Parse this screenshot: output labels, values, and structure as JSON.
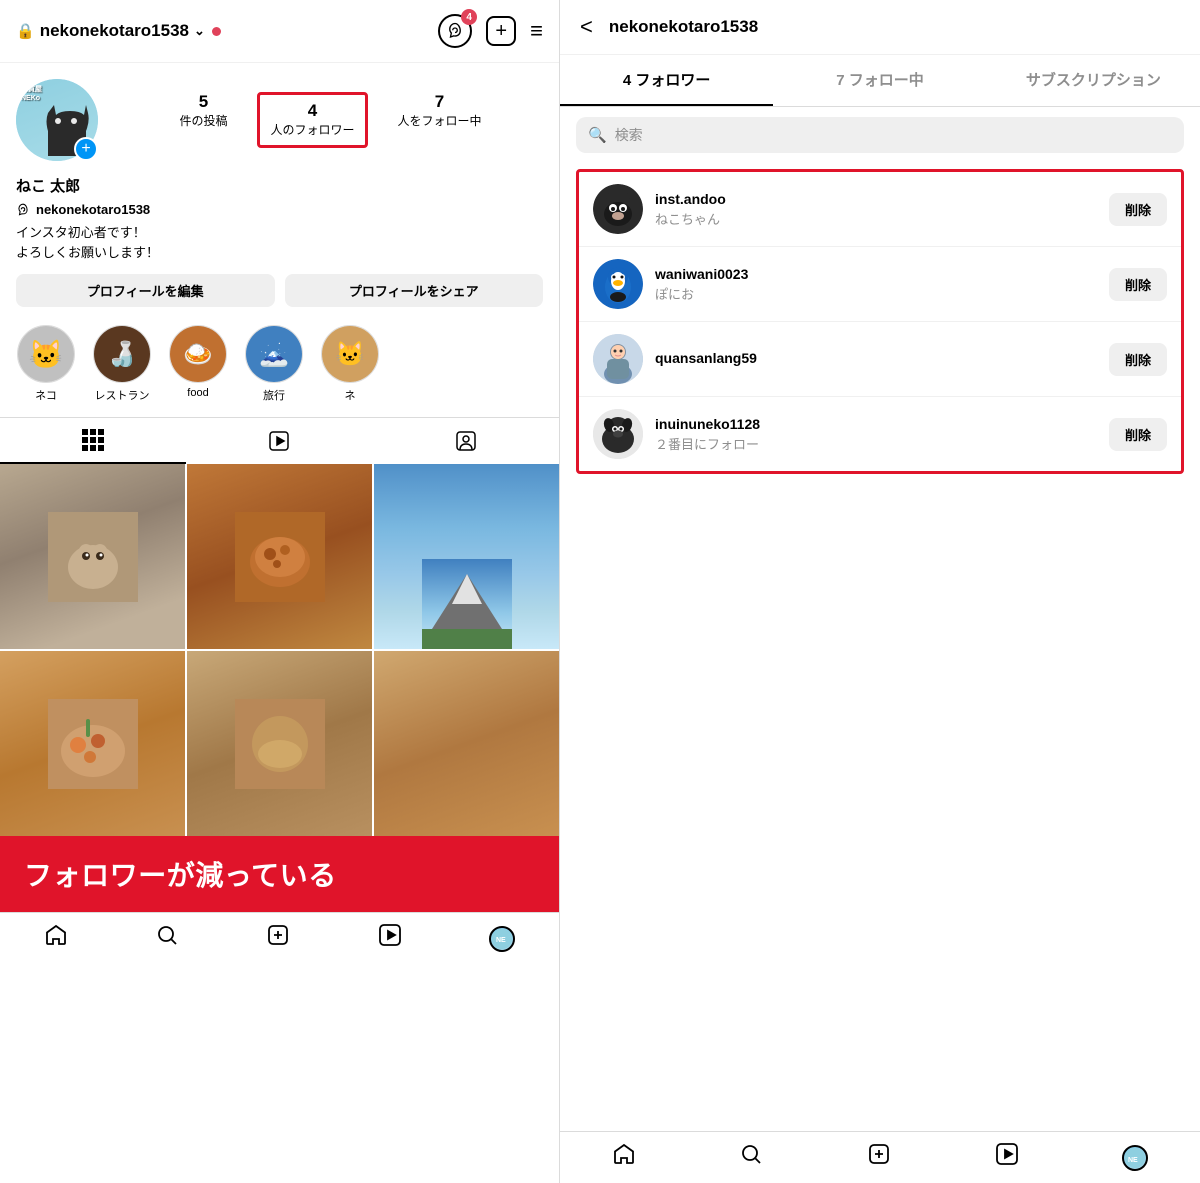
{
  "left": {
    "topbar": {
      "lock_symbol": "🔒",
      "username": "nekonekotaro1538",
      "chevron": "∨",
      "threads_label": "@",
      "badge_count": "4",
      "plus_symbol": "+",
      "menu_symbol": "≡"
    },
    "profile": {
      "name": "ねこ 太郎",
      "threads_id": "nekonekotaro1538",
      "bio_line1": "インスタ初心者です！",
      "bio_line2": "よろしくお願いします！",
      "stat_posts_number": "5",
      "stat_posts_label": "件の投稿",
      "stat_followers_number": "4",
      "stat_followers_label": "人のフォロワー",
      "stat_following_number": "7",
      "stat_following_label": "人をフォロー中",
      "edit_button": "プロフィールを編集",
      "share_button": "プロフィールをシェア",
      "avatar_label1": "雑貨屋",
      "avatar_label2": "NEKo"
    },
    "highlights": [
      {
        "label": "ネコ"
      },
      {
        "label": "レストラン"
      },
      {
        "label": "food"
      },
      {
        "label": "旅行"
      },
      {
        "label": "ネ"
      }
    ],
    "annotation": "フォロワーが減っている"
  },
  "right": {
    "topbar": {
      "back": "<",
      "username": "nekonekotaro1538"
    },
    "tabs": [
      {
        "label": "4 フォロワー",
        "active": true
      },
      {
        "label": "7 フォロー中",
        "active": false
      },
      {
        "label": "サブスクリプション",
        "active": false
      }
    ],
    "search_placeholder": "検索",
    "followers": [
      {
        "username": "inst.andoo",
        "subtext": "ねこちゃん",
        "delete_label": "削除"
      },
      {
        "username": "waniwani0023",
        "subtext": "ぽにお",
        "delete_label": "削除"
      },
      {
        "username": "quansanlang59",
        "subtext": "",
        "delete_label": "削除"
      },
      {
        "username": "inuinuneko1128",
        "subtext": "２番目にフォロー",
        "delete_label": "削除"
      }
    ]
  },
  "bottom_nav": {
    "icons": [
      "home",
      "search",
      "add",
      "reels",
      "profile"
    ]
  }
}
